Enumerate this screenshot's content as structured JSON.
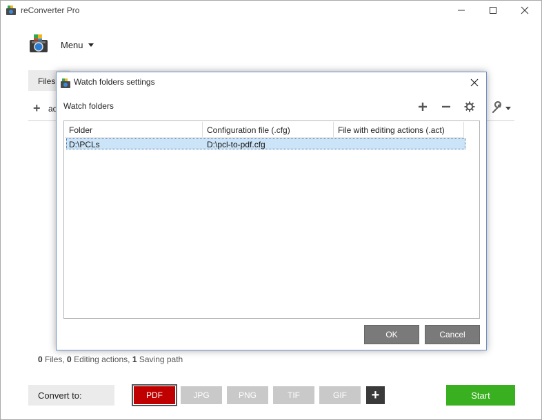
{
  "window": {
    "title": "reConverter Pro",
    "minimize_icon": "minimize-icon",
    "maximize_icon": "maximize-icon",
    "close_icon": "close-icon"
  },
  "menu": {
    "label": "Menu"
  },
  "tabs": {
    "files": "Files"
  },
  "toolbar": {
    "add_label": "ad"
  },
  "status": {
    "files_count": "0",
    "files_label": "Files,",
    "actions_count": "0",
    "actions_label": "Editing actions,",
    "paths_count": "1",
    "paths_label": "Saving path"
  },
  "convert": {
    "label": "Convert to:",
    "formats": [
      "PDF",
      "JPG",
      "PNG",
      "TIF",
      "GIF"
    ],
    "active": "PDF",
    "add_symbol": "+",
    "start_label": "Start",
    "colors": {
      "active": "#c00000",
      "inactive": "#c9c9c9",
      "start": "#39b01f"
    }
  },
  "dialog": {
    "title": "Watch folders settings",
    "section_label": "Watch folders",
    "columns": [
      "Folder",
      "Configuration file (.cfg)",
      "File with editing actions (.act)"
    ],
    "rows": [
      {
        "folder": "D:\\PCLs",
        "config": "D:\\pcl-to-pdf.cfg",
        "actions": ""
      }
    ],
    "ok_label": "OK",
    "cancel_label": "Cancel"
  }
}
